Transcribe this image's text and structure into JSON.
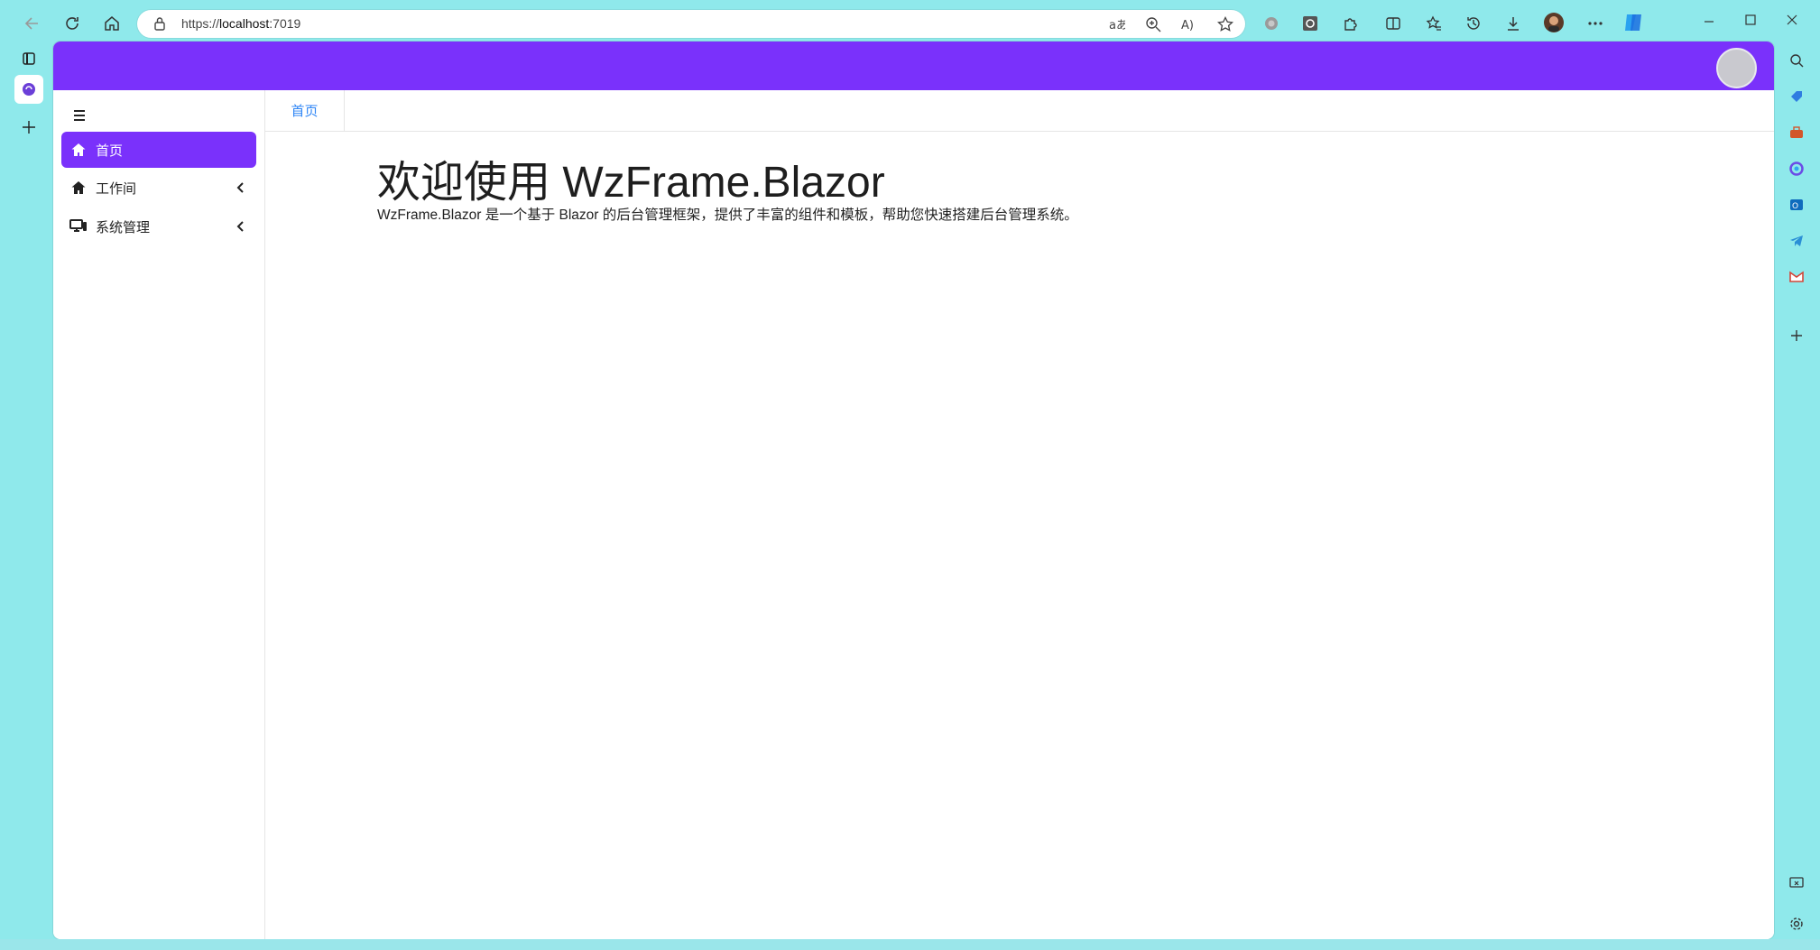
{
  "browser": {
    "url_prefix": "https://",
    "url_host": "localhost",
    "url_suffix": ":7019",
    "accent": "#8fe9eb"
  },
  "app": {
    "header_color": "#7a31fb",
    "sidebar": {
      "items": [
        {
          "label": "首页",
          "icon": "home-icon",
          "active": true
        },
        {
          "label": "工作间",
          "icon": "home-icon",
          "active": false
        },
        {
          "label": "系统管理",
          "icon": "monitor-icon",
          "active": false
        }
      ]
    },
    "tabs": [
      {
        "label": "首页",
        "active": true
      }
    ],
    "main": {
      "title": "欢迎使用 WzFrame.Blazor",
      "description": "WzFrame.Blazor 是一个基于 Blazor 的后台管理框架，提供了丰富的组件和模板，帮助您快速搭建后台管理系统。"
    }
  }
}
